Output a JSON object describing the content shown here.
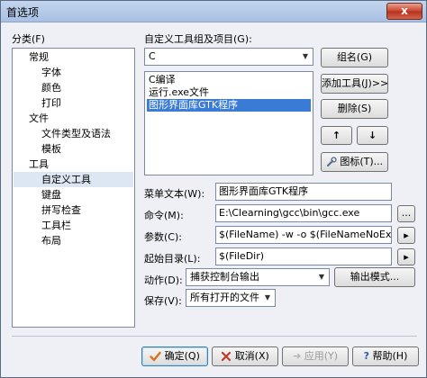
{
  "window": {
    "title": "首选项",
    "close": "x"
  },
  "categories": {
    "label": "分类(F)",
    "items": [
      {
        "label": "常规",
        "level": 1
      },
      {
        "label": "字体",
        "level": 2
      },
      {
        "label": "颜色",
        "level": 2
      },
      {
        "label": "打印",
        "level": 2
      },
      {
        "label": "文件",
        "level": 1
      },
      {
        "label": "文件类型及语法",
        "level": 2
      },
      {
        "label": "模板",
        "level": 2
      },
      {
        "label": "工具",
        "level": 1
      },
      {
        "label": "自定义工具",
        "level": 2,
        "selected": true
      },
      {
        "label": "键盘",
        "level": 1
      },
      {
        "label": "拼写检查",
        "level": 1
      },
      {
        "label": "工具栏",
        "level": 1
      },
      {
        "label": "布局",
        "level": 1
      }
    ]
  },
  "tools": {
    "group_label": "自定义工具组及项目(G):",
    "group_value": "C",
    "items": [
      {
        "label": "C编译"
      },
      {
        "label": "运行.exe文件"
      },
      {
        "label": "图形界面库GTK程序",
        "selected": true
      }
    ],
    "buttons": {
      "group_name": "组名(G)",
      "add_tool": "添加工具(J)>>",
      "delete": "删除(S)",
      "up": "↑",
      "down": "↓",
      "icon": "图标(T)..."
    }
  },
  "fields": {
    "menu_text_label": "菜单文本(W):",
    "menu_text_value": "图形界面库GTK程序",
    "command_label": "命令(M):",
    "command_value": "E:\\Clearning\\gcc\\bin\\gcc.exe",
    "command_browse": "...",
    "params_label": "参数(C):",
    "params_value": "$(FileName) -w -o $(FileNameNoExt).ex",
    "params_menu": "▸",
    "dir_label": "起始目录(L):",
    "dir_value": "$(FileDir)",
    "dir_menu": "▸",
    "action_label": "动作(D):",
    "action_value": "捕获控制台输出",
    "output_mode": "输出模式...",
    "save_label": "保存(V):",
    "save_value": "所有打开的文件"
  },
  "footer": {
    "ok": "确定(Q)",
    "cancel": "取消(X)",
    "apply": "应用(Y)",
    "help": "帮助(H)"
  },
  "colors": {
    "selection": "#3a7bd5",
    "ok": "#d9731a",
    "cancel": "#c0392b",
    "help": "#2a5fb0"
  }
}
